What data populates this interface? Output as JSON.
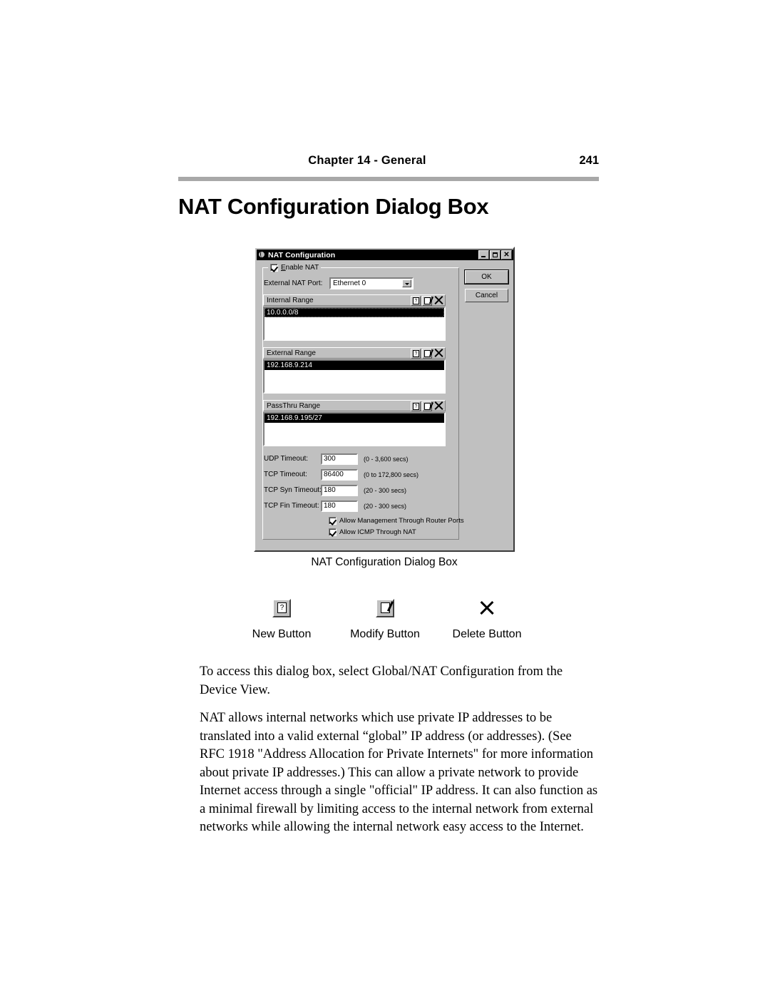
{
  "page": {
    "header": {
      "chapter": "Chapter 14 - General",
      "page_number": "241"
    },
    "section_title": "NAT Configuration Dialog Box",
    "figure_caption": "NAT Configuration Dialog Box"
  },
  "dialog": {
    "title": "NAT Configuration",
    "title_icon": "globe-icon",
    "window_controls": {
      "minimize": "minimize-icon",
      "maximize": "maximize-icon",
      "close": "close-icon",
      "close_glyph": "✕"
    },
    "enable_nat": {
      "label": "Enable NAT",
      "checked": true
    },
    "external_nat_port": {
      "label": "External NAT Port:",
      "value": "Ethernet 0",
      "options": [
        "Ethernet 0"
      ]
    },
    "ranges": [
      {
        "label": "Internal Range",
        "items": [
          "10.0.0.0/8"
        ],
        "tools": [
          "new-button",
          "modify-button",
          "delete-button"
        ]
      },
      {
        "label": "External Range",
        "items": [
          "192.168.9.214"
        ],
        "tools": [
          "new-button",
          "modify-button",
          "delete-button"
        ]
      },
      {
        "label": "PassThru Range",
        "items": [
          "192.168.9.195/27"
        ],
        "tools": [
          "new-button",
          "modify-button",
          "delete-button"
        ]
      }
    ],
    "timeouts": [
      {
        "label": "UDP Timeout:",
        "value": "300",
        "hint": "(0 - 3,600 secs)"
      },
      {
        "label": "TCP Timeout:",
        "value": "86400",
        "hint": "(0 to 172,800 secs)"
      },
      {
        "label": "TCP Syn Timeout:",
        "value": "180",
        "hint": "(20 - 300 secs)"
      },
      {
        "label": "TCP Fin Timeout:",
        "value": "180",
        "hint": "(20 - 300 secs)"
      }
    ],
    "options": [
      {
        "label": "Allow Management Through Router Ports",
        "checked": true
      },
      {
        "label": "Allow ICMP Through NAT",
        "checked": true
      }
    ],
    "buttons": {
      "ok": "OK",
      "cancel": "Cancel"
    }
  },
  "legend_buttons": [
    {
      "label": "New Button",
      "icon": "new-page-icon"
    },
    {
      "label": "Modify Button",
      "icon": "modify-pencil-icon"
    },
    {
      "label": "Delete Button",
      "icon": "delete-x-icon"
    }
  ],
  "paragraphs": [
    "To access this dialog box, select Global/NAT Configuration from the Device View.",
    "NAT allows internal networks which use private IP addresses to be translated into a valid external “global” IP address (or addresses). (See RFC 1918 \"Address Allocation for Private Internets\" for more information about private IP addresses.) This can allow a private network to provide Internet access through a single \"official\" IP address. It can also function as a minimal firewall by limiting access to the internal network from external networks while allowing the internal network easy access to the Internet."
  ],
  "colors": {
    "rule": "#a8a8a8",
    "dialog_face": "#c0c0c0",
    "titlebar": "#000000",
    "selection": "#000000"
  }
}
